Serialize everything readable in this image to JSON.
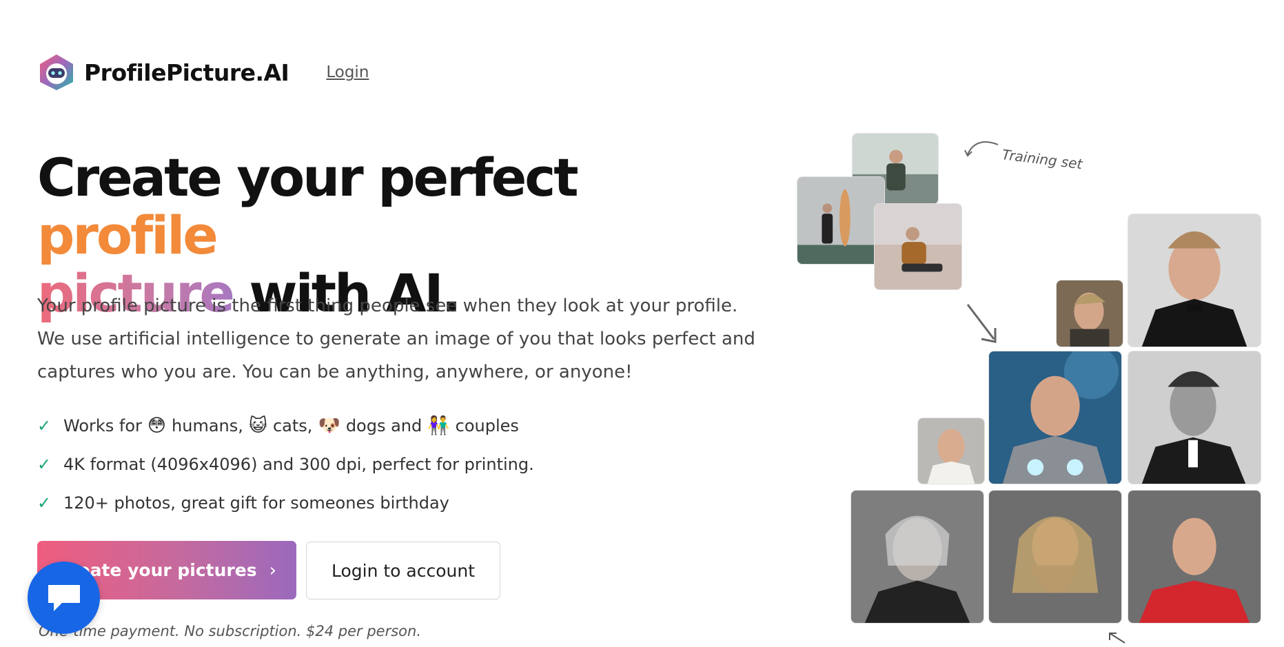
{
  "brand": {
    "name": "ProfilePicture.AI",
    "logo_icon": "camera-robot-logo"
  },
  "nav": {
    "login_label": "Login"
  },
  "hero": {
    "headline_part1": "Create your perfect ",
    "headline_highlight1": "profile",
    "headline_highlight2": "picture",
    "headline_part2": " with AI.",
    "description": "Your profile picture is the first thing people see when they look at your profile. We use artificial intelligence to generate an image of you that looks perfect and captures who you are. You can be anything, anywhere, or anyone!"
  },
  "features": [
    {
      "segments": [
        "Works for",
        "humans,",
        "cats,",
        "dogs and",
        "couples"
      ],
      "emojis": [
        "😳",
        "😺",
        "🐶",
        "👫"
      ]
    },
    {
      "text": "4K format (4096x4096) and 300 dpi, perfect for printing."
    },
    {
      "text": "120+ photos, great gift for someones birthday"
    }
  ],
  "cta": {
    "primary_label": "Create your pictures",
    "primary_chevron": "›",
    "secondary_label": "Login to account",
    "note": "One-time payment. No subscription. $24 per person."
  },
  "gallery": {
    "annotation": "Training set",
    "training_photos": [
      "man-standing-outdoors",
      "man-with-surfboard",
      "man-sitting-by-window"
    ],
    "generated_photos": [
      "tuxedo-portrait",
      "side-profile",
      "astronaut-suit-portrait",
      "bw-suit-portrait",
      "small-white-fur-portrait",
      "grey-hair-portrait",
      "long-beard-portrait",
      "red-shirt-portrait"
    ]
  },
  "colors": {
    "accent_orange": "#f28a3a",
    "gradient_pink": "#ef5d7e",
    "gradient_purple": "#9b69bd",
    "check_green": "#19a37b",
    "chat_blue": "#1766e6"
  }
}
